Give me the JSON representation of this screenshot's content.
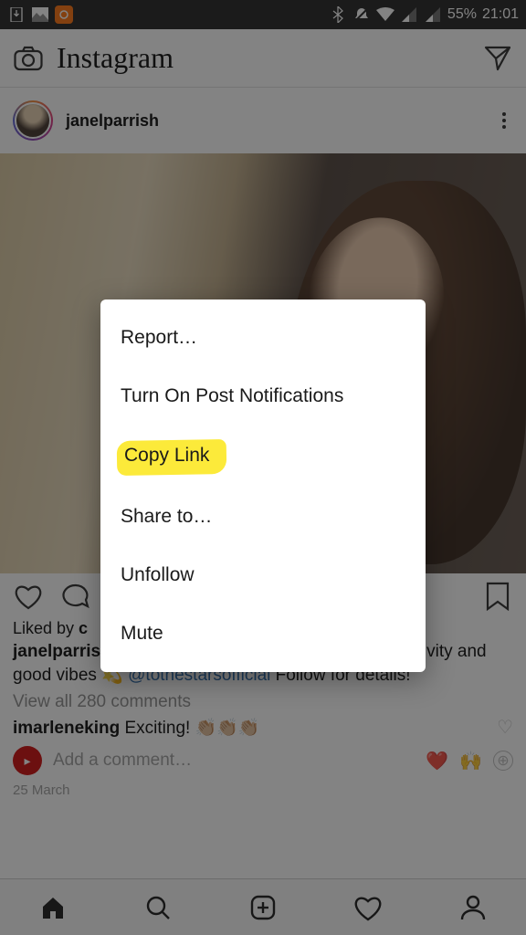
{
  "status": {
    "battery": "55%",
    "time": "21:01"
  },
  "header": {
    "brand": "Instagram"
  },
  "post": {
    "username": "janelparrish",
    "liked_by_prefix": "Liked by ",
    "liked_by_name": "c",
    "caption_user": "janelparrish",
    "caption_text_a": " Launching soon to bring you some positivity and good vibes 💫 ",
    "caption_mention": "@tothestarsofficial",
    "caption_text_b": " Follow for details!",
    "view_all": "View all 280 comments",
    "top_comment_user": "imarleneking",
    "top_comment_text": " Exciting! 👏🏼👏🏼👏🏼",
    "add_comment_placeholder": "Add a comment…",
    "date": "25 March"
  },
  "menu": {
    "items": [
      "Report…",
      "Turn On Post Notifications",
      "Copy Link",
      "Share to…",
      "Unfollow",
      "Mute"
    ]
  }
}
